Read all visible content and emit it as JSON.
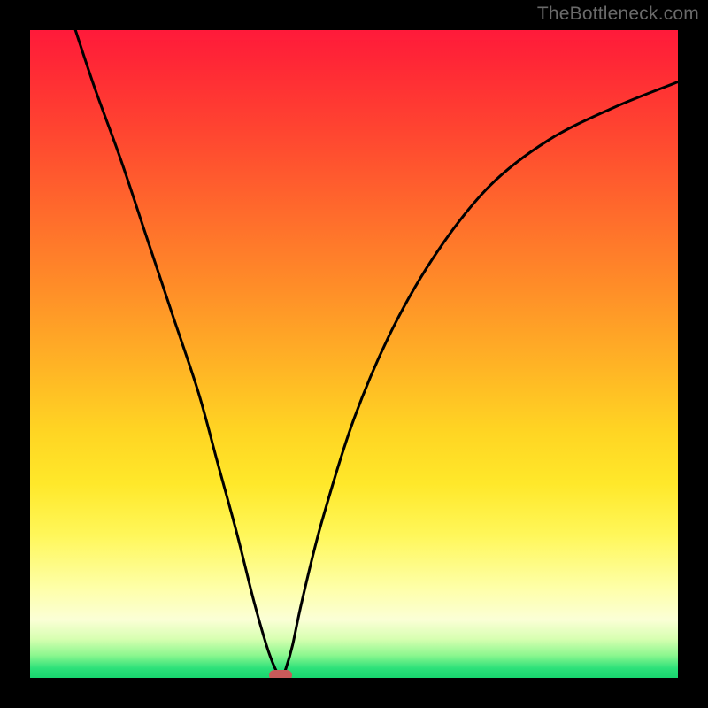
{
  "watermark": "TheBottleneck.com",
  "chart_data": {
    "type": "line",
    "title": "",
    "xlabel": "",
    "ylabel": "",
    "xlim": [
      0,
      100
    ],
    "ylim": [
      0,
      100
    ],
    "grid": false,
    "legend": false,
    "series": [
      {
        "name": "curve",
        "x": [
          7,
          10,
          14,
          18,
          22,
          26,
          29,
          32,
          34.5,
          36.5,
          37.8,
          38.5,
          39,
          39.5,
          40.5,
          42,
          45,
          50,
          56,
          63,
          71,
          80,
          90,
          100
        ],
        "values": [
          100,
          91,
          80,
          68,
          56,
          44,
          33,
          22,
          12,
          5,
          1.5,
          0.5,
          0.5,
          1.5,
          5,
          12,
          24,
          40,
          54,
          66,
          76,
          83,
          88,
          92
        ]
      }
    ],
    "marker": {
      "x": 38.7,
      "y": 0.4
    },
    "background_gradient": {
      "top": "#ff1a3a",
      "mid": "#ffe82a",
      "bottom": "#18d66f"
    }
  }
}
